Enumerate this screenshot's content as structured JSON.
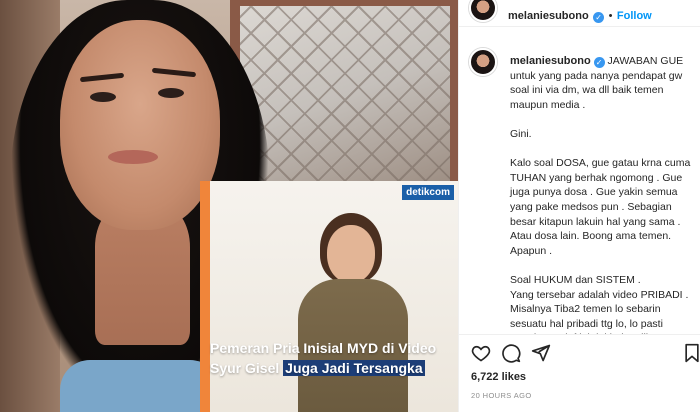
{
  "post": {
    "news_card": {
      "source_logo": "detikcom",
      "headline_plain": "Pemeran Pria Inisial MYD di Video Syur Gisel ",
      "headline_highlight": "Juga Jadi Tersangka"
    }
  },
  "sidebar": {
    "header": {
      "username": "melaniesubono",
      "verified_badge": "✓",
      "separator": "•",
      "follow_label": "Follow",
      "more_icon": "more-horizontal-icon"
    },
    "caption": {
      "username": "melaniesubono",
      "verified_badge": "✓",
      "paragraphs": [
        "JAWABAN GUE\nuntuk yang pada nanya pendapat gw soal ini via dm, wa dll baik temen maupun media .",
        "Gini.",
        "Kalo soal DOSA, gue gatau krna cuma TUHAN yang berhak ngomong . Gue juga punya dosa . Gue yakin semua yang pake medsos pun . Sebagian besar kitapun lakuin hal yang sama . Atau dosa lain. Boong ama temen. Apapun .",
        "Soal HUKUM dan SISTEM .\nYang tersebar adalah video PRIBADI .\nMisalnya Tiba2 temen lo sebarin sesuatu hal pribadi ttg lo, lo pasti marah . Tapi If lah ini bukan lihat"
      ]
    },
    "actions": {
      "icons": [
        "heart-icon",
        "comment-icon",
        "share-icon",
        "bookmark-icon"
      ],
      "likes": "6,722 likes",
      "timestamp": "20 HOURS AGO"
    }
  }
}
